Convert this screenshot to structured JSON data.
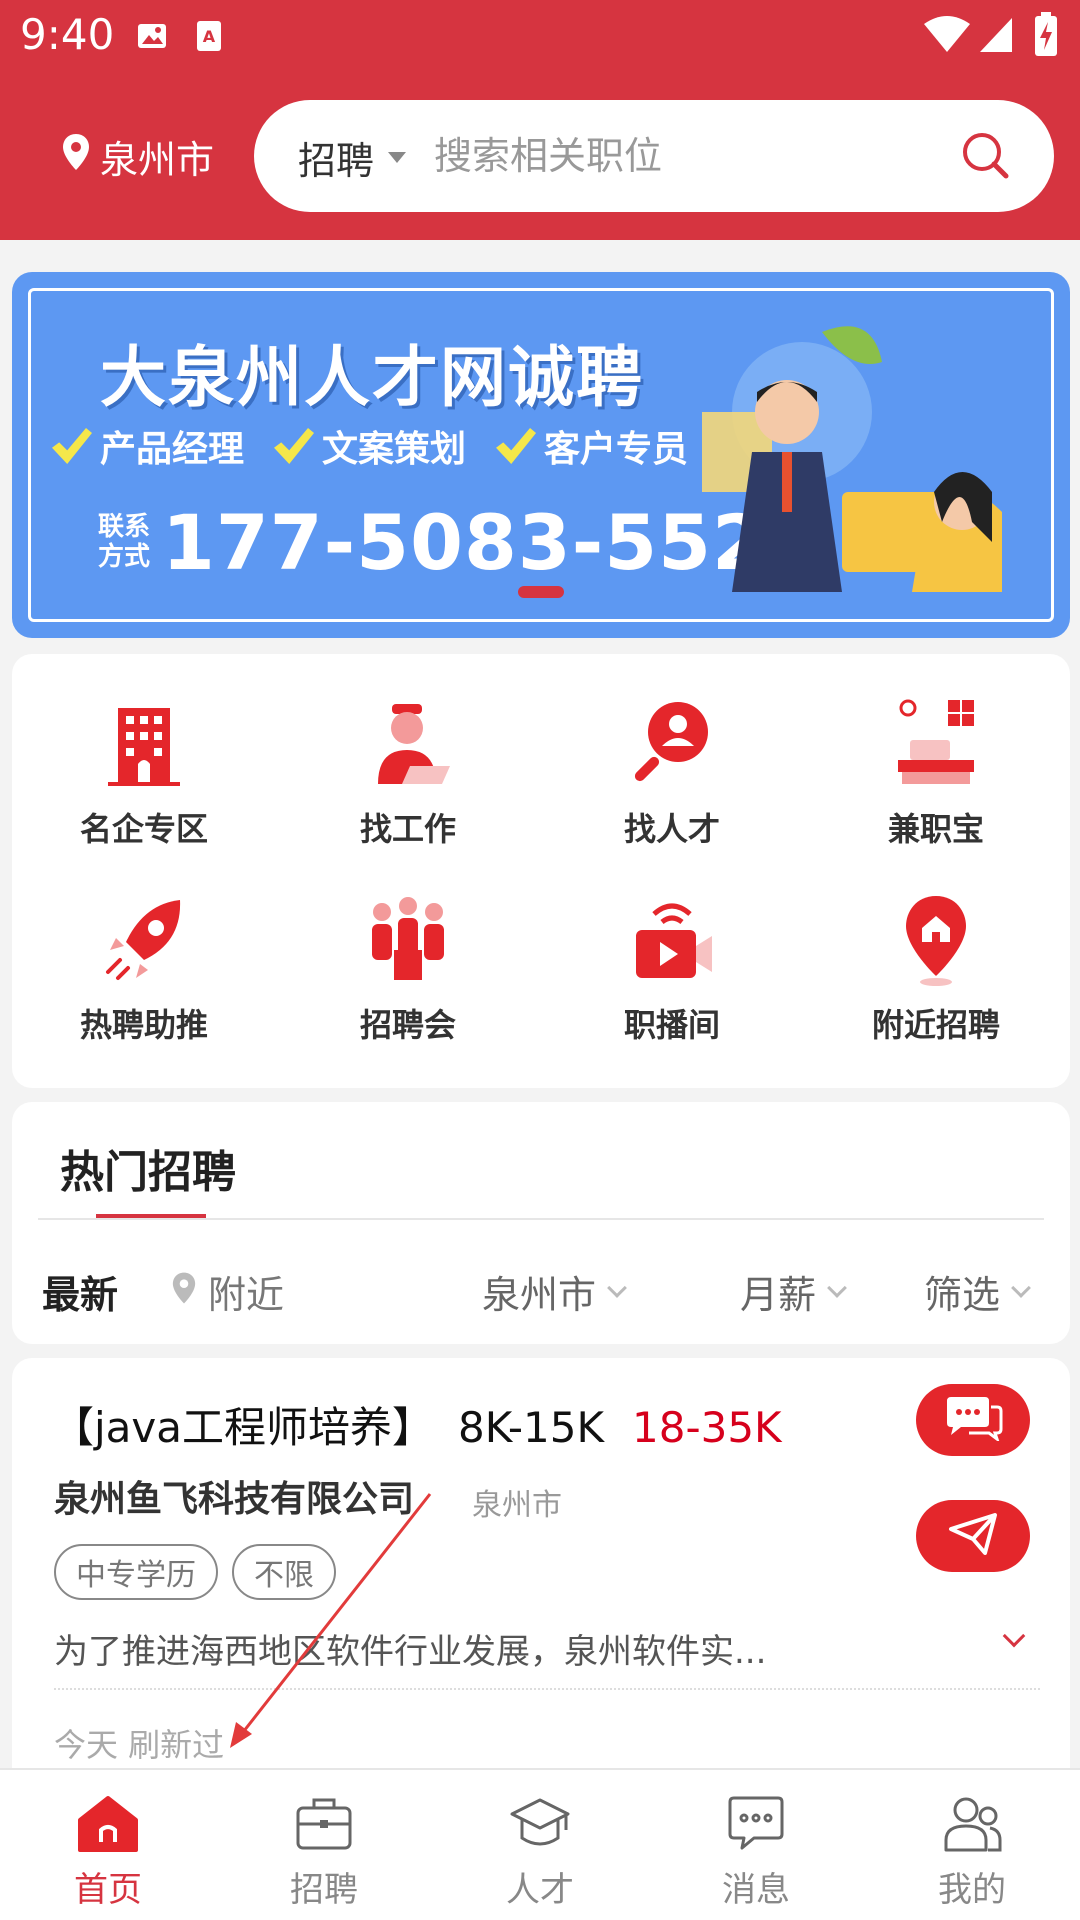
{
  "status_bar": {
    "time": "9:40"
  },
  "header": {
    "city": "泉州市",
    "search_type": "招聘",
    "search_placeholder": "搜索相关职位"
  },
  "banner": {
    "title": "大泉州人才网诚聘",
    "tags": [
      "产品经理",
      "文案策划",
      "客户专员"
    ],
    "contact_label": "联系方式",
    "phone": "177-5083-5520"
  },
  "menu": {
    "items": [
      {
        "label": "名企专区",
        "icon": "building-icon"
      },
      {
        "label": "找工作",
        "icon": "worker-icon"
      },
      {
        "label": "找人才",
        "icon": "talent-search-icon"
      },
      {
        "label": "兼职宝",
        "icon": "desk-icon"
      },
      {
        "label": "热聘助推",
        "icon": "rocket-icon"
      },
      {
        "label": "招聘会",
        "icon": "meeting-icon"
      },
      {
        "label": "职播间",
        "icon": "live-stream-icon"
      },
      {
        "label": "附近招聘",
        "icon": "location-home-icon"
      }
    ]
  },
  "hot_section": {
    "heading": "热门招聘",
    "filters": {
      "latest": "最新",
      "nearby": "附近",
      "city": "泉州市",
      "salary": "月薪",
      "filter": "筛选"
    }
  },
  "job_card": {
    "title": "【java工程师培养】",
    "salary": "8K-15K",
    "hot_salary": "18-35K",
    "company": "泉州鱼飞科技有限公司",
    "company_city": "泉州市",
    "tags": [
      "中专学历",
      "不限"
    ],
    "description": "为了推进海西地区软件行业发展，泉州软件实...",
    "refresh": "今天 刷新过"
  },
  "tabbar": {
    "tabs": [
      {
        "label": "首页",
        "icon": "home-icon",
        "active": true
      },
      {
        "label": "招聘",
        "icon": "briefcase-icon",
        "active": false
      },
      {
        "label": "人才",
        "icon": "graduation-cap-icon",
        "active": false
      },
      {
        "label": "消息",
        "icon": "message-icon",
        "active": false
      },
      {
        "label": "我的",
        "icon": "user-icon",
        "active": false
      }
    ]
  },
  "colors": {
    "primary": "#d63440",
    "banner_blue": "#5d98f2",
    "highlight_red": "#d6001c"
  }
}
